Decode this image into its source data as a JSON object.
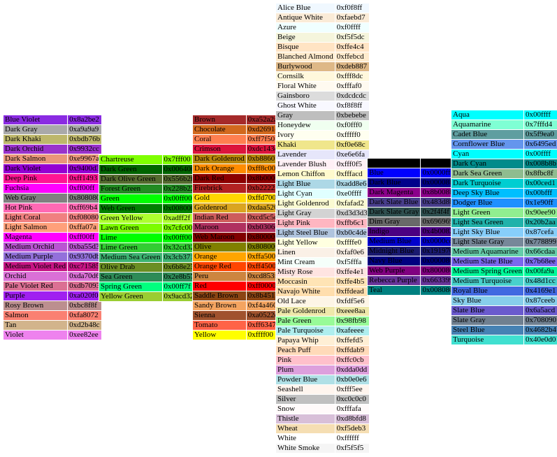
{
  "tables": [
    {
      "id": "table-1",
      "rows": [
        {
          "name": "Blue Violet",
          "hex": "0x8a2be2",
          "color": "#8a2be2"
        },
        {
          "name": "Dark Gray",
          "hex": "0xa9a9a9",
          "color": "#a9a9a9"
        },
        {
          "name": "Dark Khaki",
          "hex": "0xbdb76b",
          "color": "#bdb76b"
        },
        {
          "name": "Dark Orchid",
          "hex": "0x9932cc",
          "color": "#9932cc"
        },
        {
          "name": "Dark Salmon",
          "hex": "0xe9967a",
          "color": "#e9967a"
        },
        {
          "name": "Dark Violet",
          "hex": "0x9400d3",
          "color": "#9400d3"
        },
        {
          "name": "Deep Pink",
          "hex": "0xff1493",
          "color": "#ff1493"
        },
        {
          "name": "Fuchsia",
          "hex": "0xff00ff",
          "color": "#ff00ff"
        },
        {
          "name": "Web Gray",
          "hex": "0x808080",
          "color": "#808080"
        },
        {
          "name": "Hot Pink",
          "hex": "0xff69b4",
          "color": "#ff69b4"
        },
        {
          "name": "Light Coral",
          "hex": "0xf08080",
          "color": "#f08080"
        },
        {
          "name": "Light Salmon",
          "hex": "0xffa07a",
          "color": "#ffa07a"
        },
        {
          "name": "Magenta",
          "hex": "0xff00ff",
          "color": "#ff00ff"
        },
        {
          "name": "Medium Orchid",
          "hex": "0xba55d3",
          "color": "#ba55d3"
        },
        {
          "name": "Medium Purple",
          "hex": "0x9370db",
          "color": "#9370db"
        },
        {
          "name": "Medium Violet Red",
          "hex": "0xc71585",
          "color": "#c71585"
        },
        {
          "name": "Orchid",
          "hex": "0xda70d6",
          "color": "#da70d6"
        },
        {
          "name": "Pale Violet Red",
          "hex": "0xdb7093",
          "color": "#db7093"
        },
        {
          "name": "Purple",
          "hex": "0xa020f0",
          "color": "#a020f0"
        },
        {
          "name": "Rosy Brown",
          "hex": "0xbc8f8f",
          "color": "#bc8f8f"
        },
        {
          "name": "Salmon",
          "hex": "0xfa8072",
          "color": "#fa8072"
        },
        {
          "name": "Tan",
          "hex": "0xd2b48c",
          "color": "#d2b48c"
        },
        {
          "name": "Violet",
          "hex": "0xee82ee",
          "color": "#ee82ee"
        }
      ]
    },
    {
      "id": "table-2",
      "rows": [
        {
          "name": "Chartreuse",
          "hex": "0x7fff00",
          "color": "#7fff00"
        },
        {
          "name": "Dark Green",
          "hex": "0x006400",
          "color": "#006400"
        },
        {
          "name": "Dark Olive Green",
          "hex": "0x556b2f",
          "color": "#556b2f"
        },
        {
          "name": "Forest Green",
          "hex": "0x228b22",
          "color": "#228b22"
        },
        {
          "name": "Green",
          "hex": "0x00ff00",
          "color": "#00ff00"
        },
        {
          "name": "Web Green",
          "hex": "0x008000",
          "color": "#008000"
        },
        {
          "name": "Green Yellow",
          "hex": "0xadff2f",
          "color": "#adff2f"
        },
        {
          "name": "Lawn Green",
          "hex": "0x7cfc00",
          "color": "#7cfc00"
        },
        {
          "name": "Lime",
          "hex": "0x00ff00",
          "color": "#00ff00"
        },
        {
          "name": "Lime Green",
          "hex": "0x32cd32",
          "color": "#32cd32"
        },
        {
          "name": "Medium Sea Green",
          "hex": "0x3cb371",
          "color": "#3cb371"
        },
        {
          "name": "Olive Drab",
          "hex": "0x6b8e23",
          "color": "#6b8e23"
        },
        {
          "name": "Sea Green",
          "hex": "0x2e8b57",
          "color": "#2e8b57"
        },
        {
          "name": "Spring Green",
          "hex": "0x00ff7f",
          "color": "#00ff7f"
        },
        {
          "name": "Yellow Green",
          "hex": "0x9acd32",
          "color": "#9acd32"
        }
      ]
    },
    {
      "id": "table-3",
      "rows": [
        {
          "name": "Brown",
          "hex": "0xa52a2a",
          "color": "#a52a2a"
        },
        {
          "name": "Chocolate",
          "hex": "0xd2691e",
          "color": "#d2691e"
        },
        {
          "name": "Coral",
          "hex": "0xff7f50",
          "color": "#ff7f50"
        },
        {
          "name": "Crimson",
          "hex": "0xdc143c",
          "color": "#dc143c"
        },
        {
          "name": "Dark Goldenrod",
          "hex": "0xb8860b",
          "color": "#b8860b"
        },
        {
          "name": "Dark Orange",
          "hex": "0xff8c00",
          "color": "#ff8c00"
        },
        {
          "name": "Dark Red",
          "hex": "0x8b0000",
          "color": "#8b0000"
        },
        {
          "name": "Firebrick",
          "hex": "0xb22222",
          "color": "#b22222"
        },
        {
          "name": "Gold",
          "hex": "0xffd700",
          "color": "#ffd700"
        },
        {
          "name": "Goldenrod",
          "hex": "0xdaa520",
          "color": "#daa520"
        },
        {
          "name": "Indian Red",
          "hex": "0xcd5c5c",
          "color": "#cd5c5c"
        },
        {
          "name": "Maroon",
          "hex": "0xb03060",
          "color": "#b03060"
        },
        {
          "name": "Web Maroon",
          "hex": "0x800000",
          "color": "#800000"
        },
        {
          "name": "Olive",
          "hex": "0x808000",
          "color": "#808000"
        },
        {
          "name": "Orange",
          "hex": "0xffa500",
          "color": "#ffa500"
        },
        {
          "name": "Orange Red",
          "hex": "0xff4500",
          "color": "#ff4500"
        },
        {
          "name": "Peru",
          "hex": "0xcd853f",
          "color": "#cd853f"
        },
        {
          "name": "Red",
          "hex": "0xff0000",
          "color": "#ff0000"
        },
        {
          "name": "Saddle Brown",
          "hex": "0x8b4513",
          "color": "#8b4513"
        },
        {
          "name": "Sandy Brown",
          "hex": "0xf4a460",
          "color": "#f4a460"
        },
        {
          "name": "Sienna",
          "hex": "0xa0522d",
          "color": "#a0522d"
        },
        {
          "name": "Tomato",
          "hex": "0xff6347",
          "color": "#ff6347"
        },
        {
          "name": "Yellow",
          "hex": "0xffff00",
          "color": "#ffff00"
        }
      ]
    },
    {
      "id": "table-4",
      "rows": [
        {
          "name": "Alice Blue",
          "hex": "0xf0f8ff",
          "color": "#f0f8ff"
        },
        {
          "name": "Antique White",
          "hex": "0xfaebd7",
          "color": "#faebd7"
        },
        {
          "name": "Azure",
          "hex": "0xf0ffff",
          "color": "#f0ffff"
        },
        {
          "name": "Beige",
          "hex": "0xf5f5dc",
          "color": "#f5f5dc"
        },
        {
          "name": "Bisque",
          "hex": "0xffe4c4",
          "color": "#ffe4c4"
        },
        {
          "name": "Blanched Almond",
          "hex": "0xffebcd",
          "color": "#ffebcd"
        },
        {
          "name": "Burlywood",
          "hex": "0xdeb887",
          "color": "#deb887"
        },
        {
          "name": "Cornsilk",
          "hex": "0xfff8dc",
          "color": "#fff8dc"
        },
        {
          "name": "Floral White",
          "hex": "0xfffaf0",
          "color": "#fffaf0"
        },
        {
          "name": "Gainsboro",
          "hex": "0xdcdcdc",
          "color": "#dcdcdc"
        },
        {
          "name": "Ghost White",
          "hex": "0xf8f8ff",
          "color": "#f8f8ff"
        },
        {
          "name": "Gray",
          "hex": "0xbebebe",
          "color": "#bebebe"
        },
        {
          "name": "Honeydew",
          "hex": "0xf0fff0",
          "color": "#f0fff0"
        },
        {
          "name": "Ivory",
          "hex": "0xfffff0",
          "color": "#fffff0"
        },
        {
          "name": "Khaki",
          "hex": "0xf0e68c",
          "color": "#f0e68c"
        },
        {
          "name": "Lavender",
          "hex": "0xe6e6fa",
          "color": "#e6e6fa"
        },
        {
          "name": "Lavender Blush",
          "hex": "0xfff0f5",
          "color": "#fff0f5"
        },
        {
          "name": "Lemon Chiffon",
          "hex": "0xfffacd",
          "color": "#fffacd"
        },
        {
          "name": "Light Blue",
          "hex": "0xadd8e6",
          "color": "#add8e6"
        },
        {
          "name": "Light Cyan",
          "hex": "0xe0ffff",
          "color": "#e0ffff"
        },
        {
          "name": "Light Goldenrod",
          "hex": "0xfafad2",
          "color": "#fafad2"
        },
        {
          "name": "Light Gray",
          "hex": "0xd3d3d3",
          "color": "#d3d3d3"
        },
        {
          "name": "Light Pink",
          "hex": "0xffb6c1",
          "color": "#ffb6c1"
        },
        {
          "name": "Light Steel Blue",
          "hex": "0xb0c4de",
          "color": "#b0c4de"
        },
        {
          "name": "Light Yellow",
          "hex": "0xffffe0",
          "color": "#ffffe0"
        },
        {
          "name": "Linen",
          "hex": "0xfaf0e6",
          "color": "#faf0e6"
        },
        {
          "name": "Mint Cream",
          "hex": "0xf5fffa",
          "color": "#f5fffa"
        },
        {
          "name": "Misty Rose",
          "hex": "0xffe4e1",
          "color": "#ffe4e1"
        },
        {
          "name": "Moccasin",
          "hex": "0xffe4b5",
          "color": "#ffe4b5"
        },
        {
          "name": "Navajo White",
          "hex": "0xffdead",
          "color": "#ffdead"
        },
        {
          "name": "Old Lace",
          "hex": "0xfdf5e6",
          "color": "#fdf5e6"
        },
        {
          "name": "Pale Goldenrod",
          "hex": "0xeee8aa",
          "color": "#eee8aa"
        },
        {
          "name": "Pale Green",
          "hex": "0x98fb98",
          "color": "#98fb98"
        },
        {
          "name": "Pale Turquoise",
          "hex": "0xafeeee",
          "color": "#afeeee"
        },
        {
          "name": "Papaya Whip",
          "hex": "0xffefd5",
          "color": "#ffefd5"
        },
        {
          "name": "Peach Puff",
          "hex": "0xffdab9",
          "color": "#ffdab9"
        },
        {
          "name": "Pink",
          "hex": "0xffc0cb",
          "color": "#ffc0cb"
        },
        {
          "name": "Plum",
          "hex": "0xdda0dd",
          "color": "#dda0dd"
        },
        {
          "name": "Powder Blue",
          "hex": "0xb0e0e6",
          "color": "#b0e0e6"
        },
        {
          "name": "Seashell",
          "hex": "0xfff5ee",
          "color": "#fff5ee"
        },
        {
          "name": "Silver",
          "hex": "0xc0c0c0",
          "color": "#c0c0c0"
        },
        {
          "name": "Snow",
          "hex": "0xfffafa",
          "color": "#fffafa"
        },
        {
          "name": "Thistle",
          "hex": "0xd8bfd8",
          "color": "#d8bfd8"
        },
        {
          "name": "Wheat",
          "hex": "0xf5deb3",
          "color": "#f5deb3"
        },
        {
          "name": "White",
          "hex": "0xffffff",
          "color": "#ffffff"
        },
        {
          "name": "White Smoke",
          "hex": "0xf5f5f5",
          "color": "#f5f5f5"
        }
      ]
    },
    {
      "id": "table-5",
      "rows": [
        {
          "name": "",
          "hex": "",
          "color": "#000000"
        },
        {
          "name": "Blue",
          "hex": "0x0000ff",
          "color": "#0000ff"
        },
        {
          "name": "Dark Blue",
          "hex": "0x00008b",
          "color": "#00008b"
        },
        {
          "name": "Dark Magenta",
          "hex": "0x8b008b",
          "color": "#8b008b"
        },
        {
          "name": "Dark Slate Blue",
          "hex": "0x483d8b",
          "color": "#483d8b"
        },
        {
          "name": "Dark Slate Gray",
          "hex": "0x2f4f4f",
          "color": "#2f4f4f"
        },
        {
          "name": "Dim Gray",
          "hex": "0x696969",
          "color": "#696969"
        },
        {
          "name": "Indigo",
          "hex": "0x4b0082",
          "color": "#4b0082"
        },
        {
          "name": "Medium Blue",
          "hex": "0x0000cd",
          "color": "#0000cd"
        },
        {
          "name": "Midnight Blue",
          "hex": "0x191970",
          "color": "#191970"
        },
        {
          "name": "Navy Blue",
          "hex": "0x000080",
          "color": "#000080"
        },
        {
          "name": "Web Purple",
          "hex": "0x800080",
          "color": "#800080"
        },
        {
          "name": "Rebecca Purple",
          "hex": "0x663399",
          "color": "#663399"
        },
        {
          "name": "Teal",
          "hex": "0x008080",
          "color": "#008080"
        }
      ]
    },
    {
      "id": "table-6",
      "rows": [
        {
          "name": "Aqua",
          "hex": "0x00ffff",
          "color": "#00ffff"
        },
        {
          "name": "Aquamarine",
          "hex": "0x7fffd4",
          "color": "#7fffd4"
        },
        {
          "name": "Cadet Blue",
          "hex": "0x5f9ea0",
          "color": "#5f9ea0"
        },
        {
          "name": "Cornflower Blue",
          "hex": "0x6495ed",
          "color": "#6495ed"
        },
        {
          "name": "Cyan",
          "hex": "0x00ffff",
          "color": "#00ffff"
        },
        {
          "name": "Dark Cyan",
          "hex": "0x008b8b",
          "color": "#008b8b"
        },
        {
          "name": "Dark Sea Green",
          "hex": "0x8fbc8f",
          "color": "#8fbc8f"
        },
        {
          "name": "Dark Turquoise",
          "hex": "0x00ced1",
          "color": "#00ced1"
        },
        {
          "name": "Deep Sky Blue",
          "hex": "0x00bfff",
          "color": "#00bfff"
        },
        {
          "name": "Dodger Blue",
          "hex": "0x1e90ff",
          "color": "#1e90ff"
        },
        {
          "name": "Light Green",
          "hex": "0x90ee90",
          "color": "#90ee90"
        },
        {
          "name": "Light Sea Green",
          "hex": "0x20b2aa",
          "color": "#20b2aa"
        },
        {
          "name": "Light Sky Blue",
          "hex": "0x87cefa",
          "color": "#87cefa"
        },
        {
          "name": "Light Slate Gray",
          "hex": "0x778899",
          "color": "#778899"
        },
        {
          "name": "Medium Aquamarine",
          "hex": "0x66cdaa",
          "color": "#66cdaa"
        },
        {
          "name": "Medium Slate Blue",
          "hex": "0x7b68ee",
          "color": "#7b68ee"
        },
        {
          "name": "Medium Spring Green",
          "hex": "0x00fa9a",
          "color": "#00fa9a"
        },
        {
          "name": "Medium Turquoise",
          "hex": "0x48d1cc",
          "color": "#48d1cc"
        },
        {
          "name": "Royal Blue",
          "hex": "0x4169e1",
          "color": "#4169e1"
        },
        {
          "name": "Sky Blue",
          "hex": "0x87ceeb",
          "color": "#87ceeb"
        },
        {
          "name": "Slate Blue",
          "hex": "0x6a5acd",
          "color": "#6a5acd"
        },
        {
          "name": "Slate Gray",
          "hex": "0x708090",
          "color": "#708090"
        },
        {
          "name": "Steel Blue",
          "hex": "0x4682b4",
          "color": "#4682b4"
        },
        {
          "name": "Turquoise",
          "hex": "0x40e0d0",
          "color": "#40e0d0"
        }
      ]
    }
  ]
}
